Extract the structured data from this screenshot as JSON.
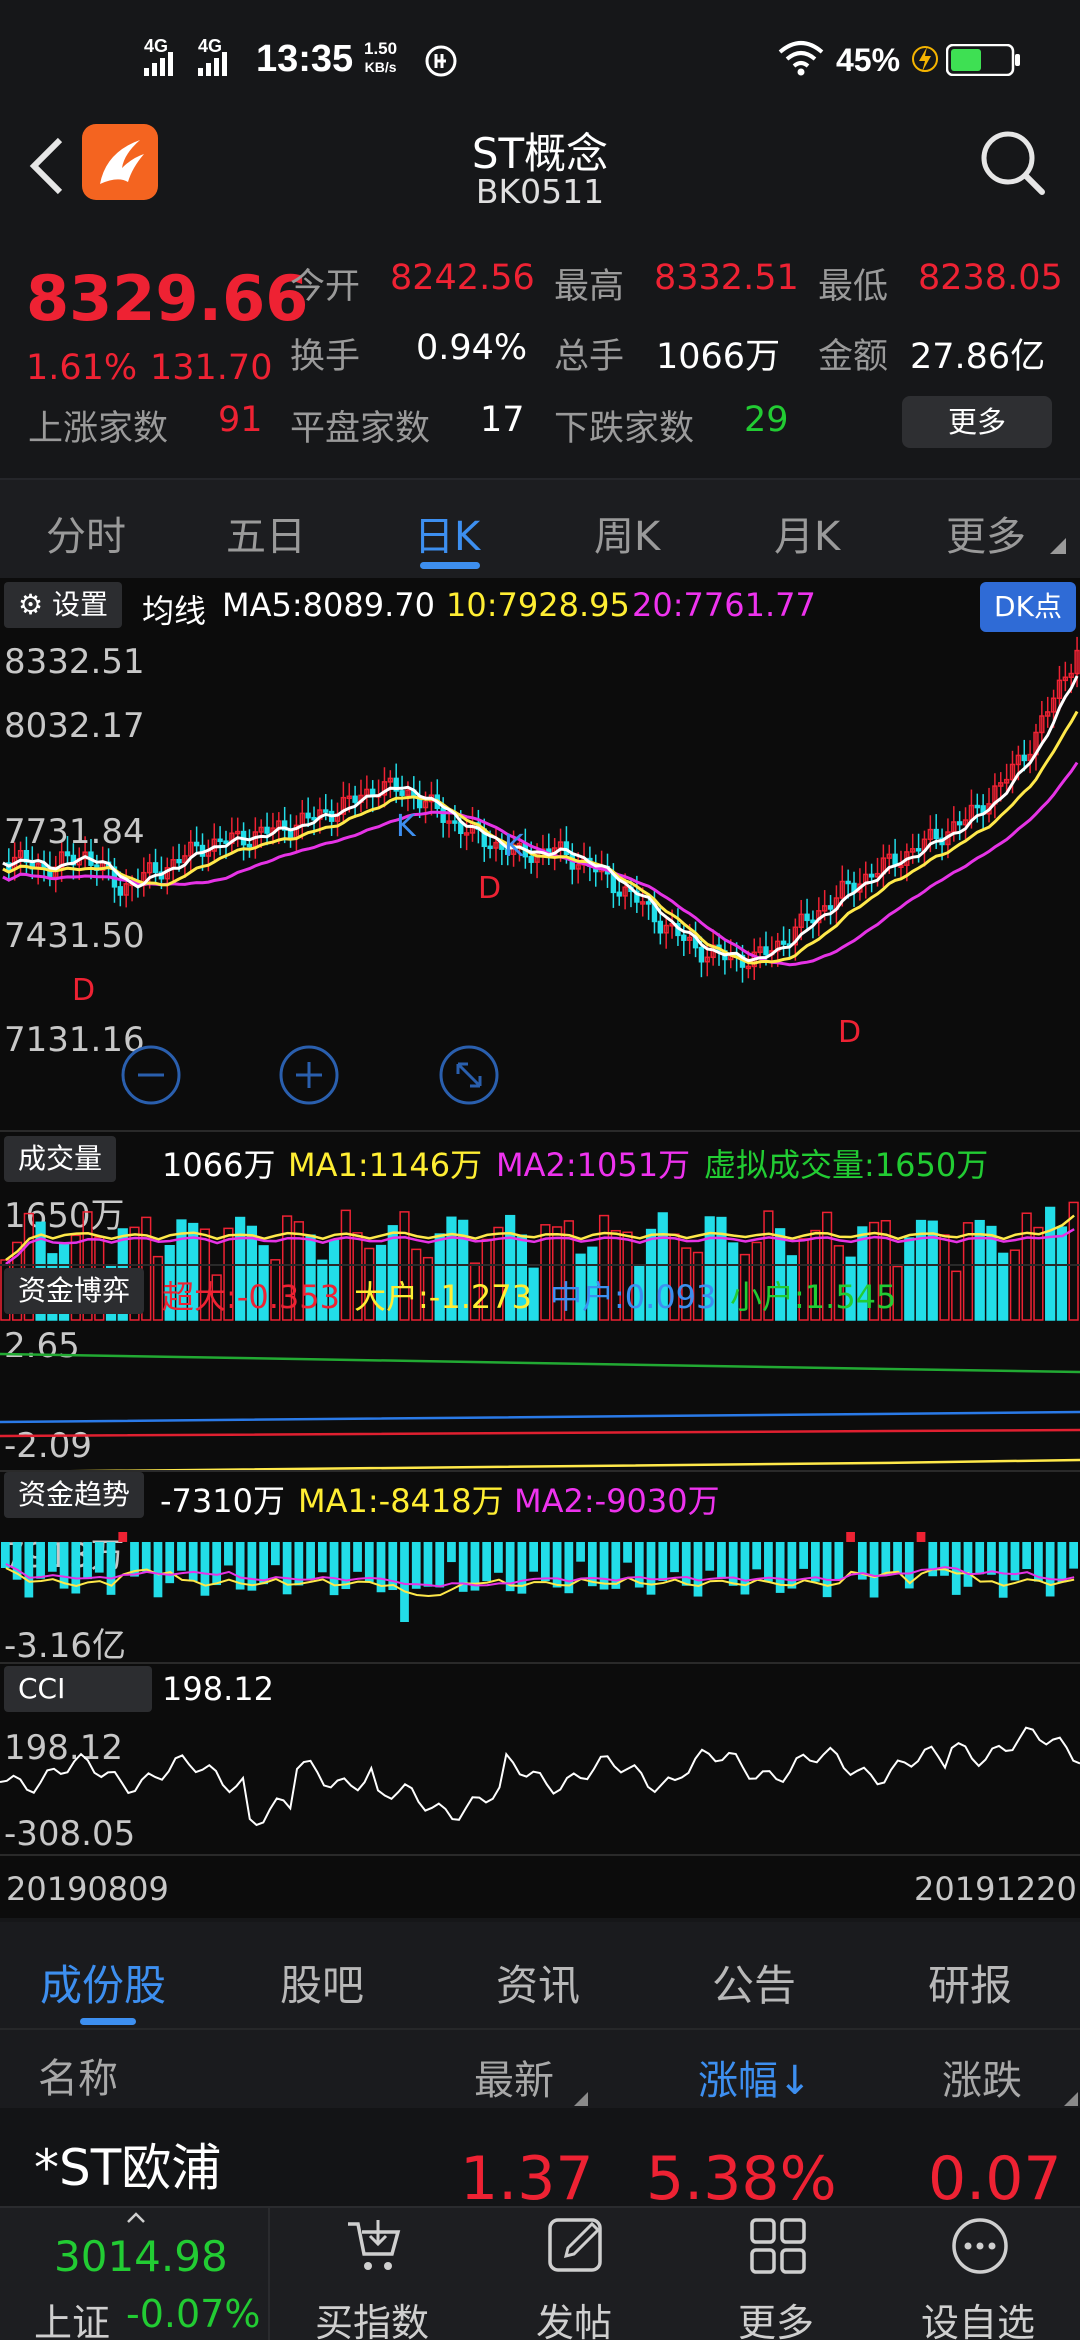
{
  "status_bar": {
    "network1": "4G",
    "network2": "4G",
    "time": "13:35",
    "speed_value": "1.50",
    "speed_unit": "KB/s",
    "battery": "45%"
  },
  "header": {
    "title": "ST概念",
    "code": "BK0511"
  },
  "quote": {
    "price": "8329.66",
    "change_pct": "1.61%",
    "change_val": "131.70",
    "open_label": "今开",
    "open": "8242.56",
    "high_label": "最高",
    "high": "8332.51",
    "low_label": "最低",
    "low": "8238.05",
    "turnover_label": "换手",
    "turnover": "0.94%",
    "volume_label": "总手",
    "volume": "1066万",
    "amount_label": "金额",
    "amount": "27.86亿",
    "up_label": "上涨家数",
    "up_count": "91",
    "flat_label": "平盘家数",
    "flat_count": "17",
    "down_label": "下跌家数",
    "down_count": "29",
    "more_label": "更多"
  },
  "chart_tabs": [
    "分时",
    "五日",
    "日K",
    "周K",
    "月K",
    "更多"
  ],
  "chart_tab_active": 2,
  "kline": {
    "settings_label": "设置",
    "ma_title": "均线",
    "ma5": "MA5:8089.70",
    "ma10": "10:7928.95",
    "ma20": "20:7761.77",
    "dk_label": "DK点",
    "axis": [
      "8332.51",
      "8032.17",
      "7731.84",
      "7431.50",
      "7131.16"
    ]
  },
  "volume": {
    "label": "成交量",
    "value": "1066万",
    "ma1": "MA1:1146万",
    "ma2": "MA2:1051万",
    "virtual": "虚拟成交量:1650万",
    "axis_top": "1650万"
  },
  "fund_game": {
    "label": "资金博弈",
    "super": "超大:-0.353",
    "large": "大户:-1.273",
    "medium": "中户:0.093",
    "small": "小户:1.545",
    "axis_top": "2.65",
    "axis_bottom": "-2.09"
  },
  "fund_trend": {
    "label": "资金趋势",
    "value": "-7310万",
    "ma1": "MA1:-8418万",
    "ma2": "MA2:-9030万",
    "axis_top": "7913万",
    "axis_bottom": "-3.16亿"
  },
  "cci": {
    "label": "CCI",
    "value": "198.12",
    "axis_top": "198.12",
    "axis_bottom": "-308.05"
  },
  "dates": {
    "start": "20190809",
    "end": "20191220"
  },
  "sub_tabs": [
    "成份股",
    "股吧",
    "资讯",
    "公告",
    "研报"
  ],
  "list": {
    "col_name": "名称",
    "col_latest": "最新",
    "col_pct": "涨幅↓",
    "col_change": "涨跌",
    "row_name": "*ST欧浦",
    "row_latest": "1.37",
    "row_pct": "5.38%",
    "row_change": "0.07"
  },
  "bottom_nav": {
    "index_value": "3014.98",
    "index_name": "上证",
    "index_change": "-0.07%",
    "buy_index": "买指数",
    "post": "发帖",
    "more": "更多",
    "watchlist": "设自选"
  },
  "colors": {
    "red": "#ee2233",
    "cyan": "#22dde8",
    "green": "#22cc33",
    "blue": "#3d8ff0",
    "yellow": "#ffee33",
    "magenta": "#ee33ee"
  }
}
